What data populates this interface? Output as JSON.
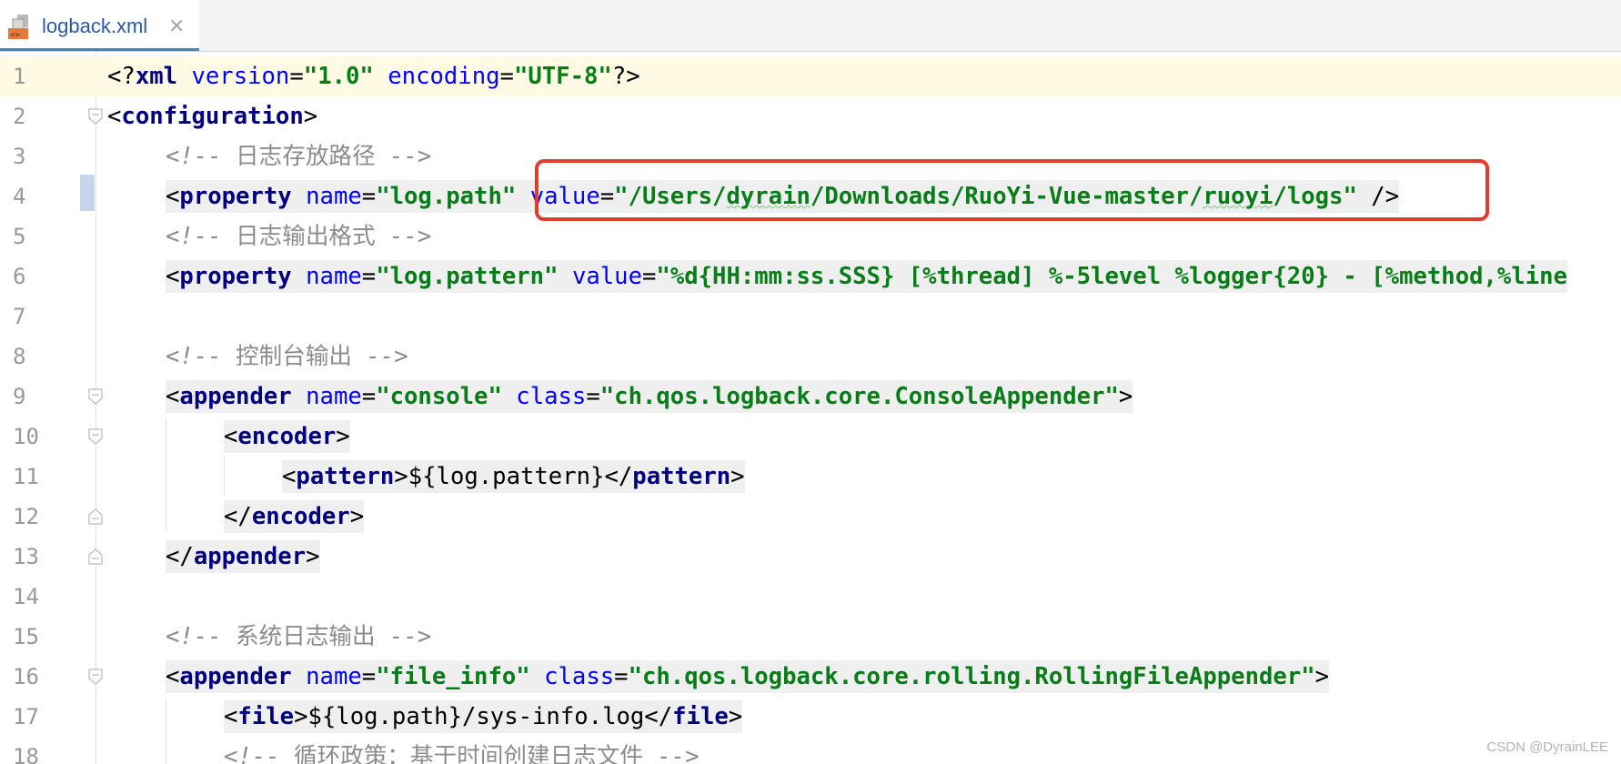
{
  "tab": {
    "title": "logback.xml",
    "close": "×"
  },
  "lines": {
    "n1": "1",
    "n2": "2",
    "n3": "3",
    "n4": "4",
    "n5": "5",
    "n6": "6",
    "n7": "7",
    "n8": "8",
    "n9": "9",
    "n10": "10",
    "n11": "11",
    "n12": "12",
    "n13": "13",
    "n14": "14",
    "n15": "15",
    "n16": "16",
    "n17": "17",
    "n18": "18"
  },
  "code": {
    "l1": {
      "version": "\"1.0\"",
      "encoding": "\"UTF-8\""
    },
    "l2": {
      "tag": "configuration"
    },
    "l3": {
      "comment": "日志存放路径"
    },
    "l4": {
      "name": "\"log.path\"",
      "value_start": "\"/Users/",
      "value_user": "dyrain",
      "value_mid": "/Downloads/RuoYi-Vue-master/",
      "value_dir": "ruoyi",
      "value_end": "/logs\""
    },
    "l5": {
      "comment": "日志输出格式"
    },
    "l6": {
      "name": "\"log.pattern\"",
      "value": "\"%d{HH:mm:ss.SSS} [%thread] %-5level %logger{20} - [%method,%line"
    },
    "l8": {
      "comment": "控制台输出"
    },
    "l9": {
      "name": "\"console\"",
      "class": "\"ch.qos.logback.core.ConsoleAppender\""
    },
    "l11": {
      "content": "${log.pattern}"
    },
    "l15": {
      "comment": "系统日志输出"
    },
    "l16": {
      "name": "\"file_info\"",
      "class": "\"ch.qos.logback.core.rolling.RollingFileAppender\""
    },
    "l17": {
      "content": "${log.path}/sys-info.log"
    },
    "l18": {
      "comment": "循环政策：基于时间创建日志文件"
    }
  },
  "watermark": "CSDN @DyrainLEE",
  "colors": {
    "tag": "#000080",
    "attribute": "#0000ff",
    "value": "#067d17",
    "comment": "#8c8c8c",
    "callout": "#e23c2c",
    "current_line": "#fefae3"
  }
}
